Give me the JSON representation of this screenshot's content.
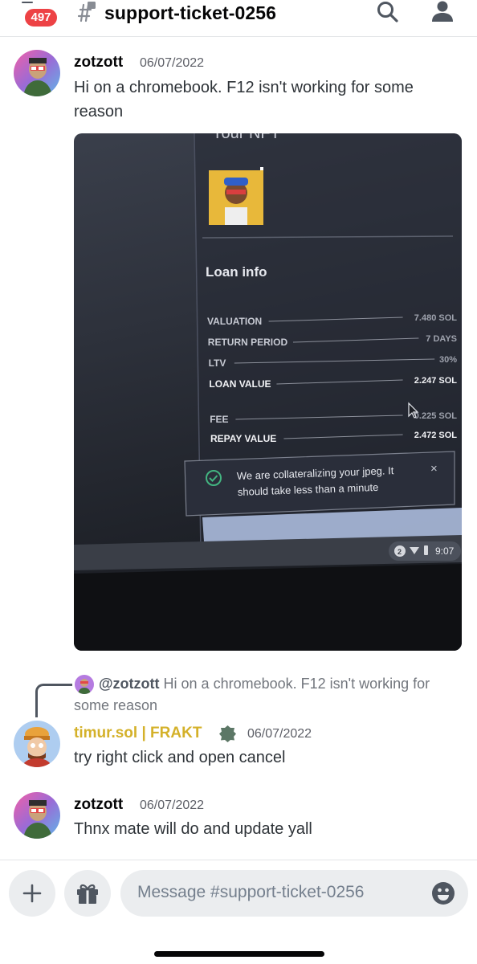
{
  "header": {
    "unread_count": "497",
    "channel_name": "support-ticket-0256",
    "icons": [
      "hash-lock-icon",
      "search-icon",
      "members-icon"
    ]
  },
  "messages": [
    {
      "author": "zotzott",
      "timestamp": "06/07/2022",
      "text": "Hi on a chromebook. F12 isn't working for some reason",
      "attachment": {
        "type": "photo",
        "screen": {
          "partial_heading": "Your NFT",
          "section_title": "Loan info",
          "rows": [
            {
              "label": "VALUATION",
              "value": "7.480 SOL"
            },
            {
              "label": "RETURN PERIOD",
              "value": "7 DAYS"
            },
            {
              "label": "LTV",
              "value": "30%"
            },
            {
              "label": "LOAN VALUE",
              "value": "2.247 SOL"
            },
            {
              "label": "FEE",
              "value": "0.225 SOL"
            },
            {
              "label": "REPAY VALUE",
              "value": "2.472 SOL"
            }
          ],
          "toast_line1": "We are collateralizing your jpeg. It",
          "toast_line2": "should take less than a minute",
          "toast_close": "×",
          "taskbar_badge": "2",
          "taskbar_time": "9:07"
        }
      }
    },
    {
      "reply_to": {
        "mention": "@zotzott",
        "text": " Hi on a chromebook. F12 isn't working for some reason"
      },
      "author": "timur.sol | FRAKT",
      "author_color": "#d4b12a",
      "timestamp": "06/07/2022",
      "text": "try right click and open cancel"
    },
    {
      "author": "zotzott",
      "timestamp": "06/07/2022",
      "text": "Thnx mate will do and update yall"
    }
  ],
  "composer": {
    "placeholder": "Message #support-ticket-0256",
    "icons": [
      "plus-icon",
      "gift-icon",
      "emoji-icon"
    ]
  },
  "colors": {
    "badge_red": "#ed4245",
    "author_gold": "#d4b12a",
    "verified_green": "#5c7766",
    "toast_check": "#43b581"
  }
}
